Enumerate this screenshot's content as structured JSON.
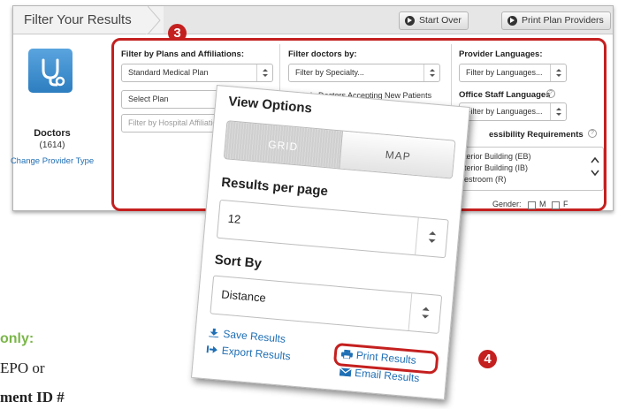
{
  "header": {
    "title": "Filter Your Results",
    "start_over_label": "Start Over",
    "print_providers_label": "Print Plan Providers"
  },
  "badges": {
    "step3": "3",
    "step4": "4"
  },
  "provider_type": {
    "icon": "stethoscope-icon",
    "name": "Doctors",
    "count": "(1614)",
    "change_link": "Change Provider Type"
  },
  "filters": {
    "plans_title": "Filter by Plans and Affiliations:",
    "plan_value": "Standard Medical Plan",
    "select_plan": "Select Plan",
    "hospital_placeholder": "Filter by Hospital Affiliation",
    "doctors_title": "Filter doctors by:",
    "specialty_value": "Filter by Specialty...",
    "new_patients_label": "Only Doctors Accepting New Patients",
    "languages_title": "Provider Languages:",
    "languages_value": "Filter by Languages...",
    "office_staff_title": "Office Staff Languages",
    "office_staff_value": "Filter by Languages...",
    "accessibility_title": "Accessibility Requirements",
    "accessibility_title_visible": "essibility Requirements",
    "accessibility_items": [
      "Exterior Building (EB)",
      "Interior Building (IB)",
      "Restroom (R)"
    ],
    "accessibility_items_visible": [
      "terior Building (EB)",
      "terior Building (IB)",
      "estroom (R)"
    ],
    "gender_label": "Gender:",
    "gender_options": [
      "M",
      "F"
    ]
  },
  "view_options": {
    "title": "View Options",
    "toggle": {
      "grid": "GRID",
      "map": "MAP",
      "active": "grid"
    },
    "results_per_page_label": "Results per page",
    "results_per_page_value": "12",
    "sort_by_label": "Sort By",
    "sort_by_value": "Distance",
    "save_results": "Save Results",
    "export_results": "Export Results",
    "print_results": "Print Results",
    "email_results": "Email Results"
  },
  "notes": {
    "only": "only:",
    "epo": "EPO or",
    "member_id": "ment ID #"
  },
  "colors": {
    "accent_red": "#c4201f",
    "link_blue": "#1f6fb5",
    "tile_blue": "#3d8fd2",
    "note_green": "#7ab648"
  }
}
